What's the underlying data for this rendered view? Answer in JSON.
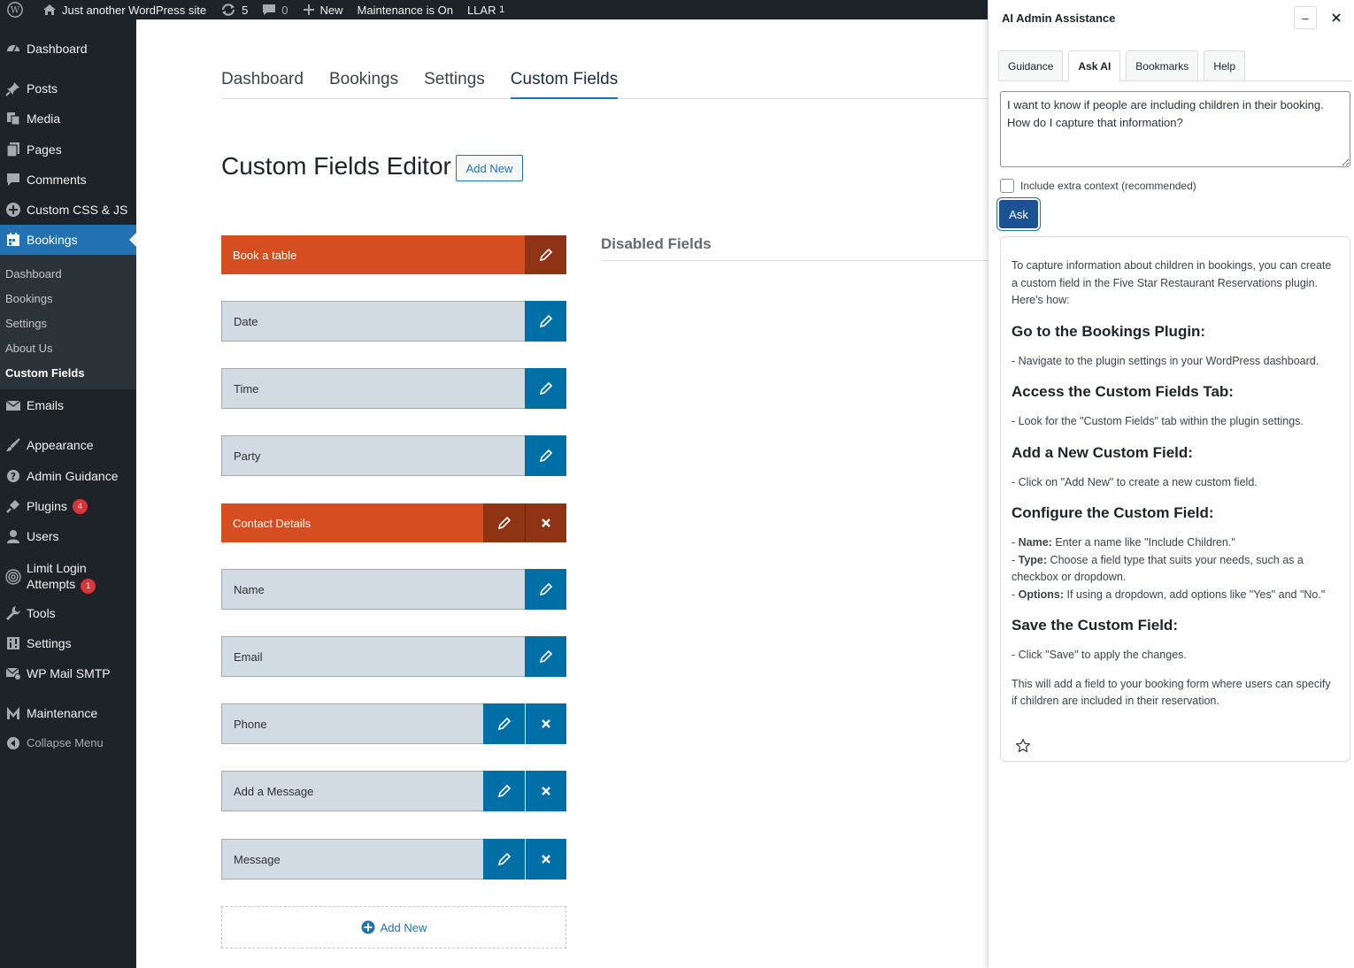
{
  "adminbar": {
    "site_name": "Just another WordPress site",
    "updates_count": "5",
    "comments_count": "0",
    "new_label": "New",
    "maintenance_label": "Maintenance is On",
    "llar_label": "LLAR",
    "llar_count": "1"
  },
  "sidebar": {
    "items": [
      {
        "label": "Dashboard",
        "icon": "dashboard-icon"
      },
      {
        "label": "Posts",
        "icon": "pin-icon"
      },
      {
        "label": "Media",
        "icon": "media-icon"
      },
      {
        "label": "Pages",
        "icon": "pages-icon"
      },
      {
        "label": "Comments",
        "icon": "comment-icon"
      },
      {
        "label": "Custom CSS & JS",
        "icon": "plus-circle-icon"
      },
      {
        "label": "Bookings",
        "icon": "calendar-icon"
      },
      {
        "label": "Emails",
        "icon": "envelope-icon"
      },
      {
        "label": "Appearance",
        "icon": "brush-icon"
      },
      {
        "label": "Admin Guidance",
        "icon": "question-icon"
      },
      {
        "label": "Plugins",
        "icon": "plug-icon",
        "badge": "4"
      },
      {
        "label": "Users",
        "icon": "user-icon"
      },
      {
        "label": "Limit Login Attempts",
        "icon": "fingerprint-icon",
        "badge": "1"
      },
      {
        "label": "Tools",
        "icon": "wrench-icon"
      },
      {
        "label": "Settings",
        "icon": "sliders-icon"
      },
      {
        "label": "WP Mail SMTP",
        "icon": "mail-icon"
      },
      {
        "label": "Maintenance",
        "icon": "m-icon"
      },
      {
        "label": "Collapse Menu",
        "icon": "collapse-icon"
      }
    ],
    "submenu": [
      "Dashboard",
      "Bookings",
      "Settings",
      "About Us",
      "Custom Fields"
    ]
  },
  "main": {
    "tabs": [
      "Dashboard",
      "Bookings",
      "Settings",
      "Custom Fields"
    ],
    "active_tab": "Custom Fields",
    "page_title": "Custom Fields Editor",
    "add_new_label": "Add New",
    "disabled_title": "Disabled Fields",
    "fields": [
      {
        "label": "Book a table",
        "kind": "group",
        "deletable": false
      },
      {
        "label": "Date",
        "kind": "normal",
        "deletable": false
      },
      {
        "label": "Time",
        "kind": "normal",
        "deletable": false
      },
      {
        "label": "Party",
        "kind": "normal",
        "deletable": false
      },
      {
        "label": "Contact Details",
        "kind": "group",
        "deletable": true
      },
      {
        "label": "Name",
        "kind": "normal",
        "deletable": false
      },
      {
        "label": "Email",
        "kind": "normal",
        "deletable": false
      },
      {
        "label": "Phone",
        "kind": "normal",
        "deletable": true
      },
      {
        "label": "Add a Message",
        "kind": "normal",
        "deletable": true
      },
      {
        "label": "Message",
        "kind": "normal",
        "deletable": true
      }
    ],
    "add_new_field_label": "Add New"
  },
  "panel": {
    "title": "AI Admin Assistance",
    "minimize_label": "–",
    "tabs": [
      "Guidance",
      "Ask AI",
      "Bookmarks",
      "Help"
    ],
    "active_tab": "Ask AI",
    "question": "I want to know if people are including children in their booking. How do I capture that information?",
    "context_label": "Include extra context (recommended)",
    "context_checked": false,
    "ask_label": "Ask",
    "answer": {
      "intro": "To capture information about children in bookings, you can create a custom field in the Five Star Restaurant Reservations plugin. Here's how:",
      "s1_title": "Go to the Bookings Plugin:",
      "s1_text": "- Navigate to the plugin settings in your WordPress dashboard.",
      "s2_title": "Access the Custom Fields Tab:",
      "s2_text": "- Look for the \"Custom Fields\" tab within the plugin settings.",
      "s3_title": "Add a New Custom Field:",
      "s3_text": "- Click on \"Add New\" to create a new custom field.",
      "s4_title": "Configure the Custom Field:",
      "s4_name_label": "Name:",
      "s4_name_text": " Enter a name like \"Include Children.\"",
      "s4_type_label": "Type:",
      "s4_type_text": " Choose a field type that suits your needs, such as a checkbox or dropdown.",
      "s4_options_label": "Options:",
      "s4_options_text": " If using a dropdown, add options like \"Yes\" and \"No.\"",
      "s5_title": "Save the Custom Field:",
      "s5_text": "- Click \"Save\" to apply the changes.",
      "outro": "This will add a field to your booking form where users can specify if children are included in their reservation."
    }
  },
  "colors": {
    "admin_dark": "#1d2327",
    "accent": "#2271b1",
    "group_orange": "#d54e21",
    "field_blue": "#006fa6",
    "ask_button": "#1a5293"
  }
}
